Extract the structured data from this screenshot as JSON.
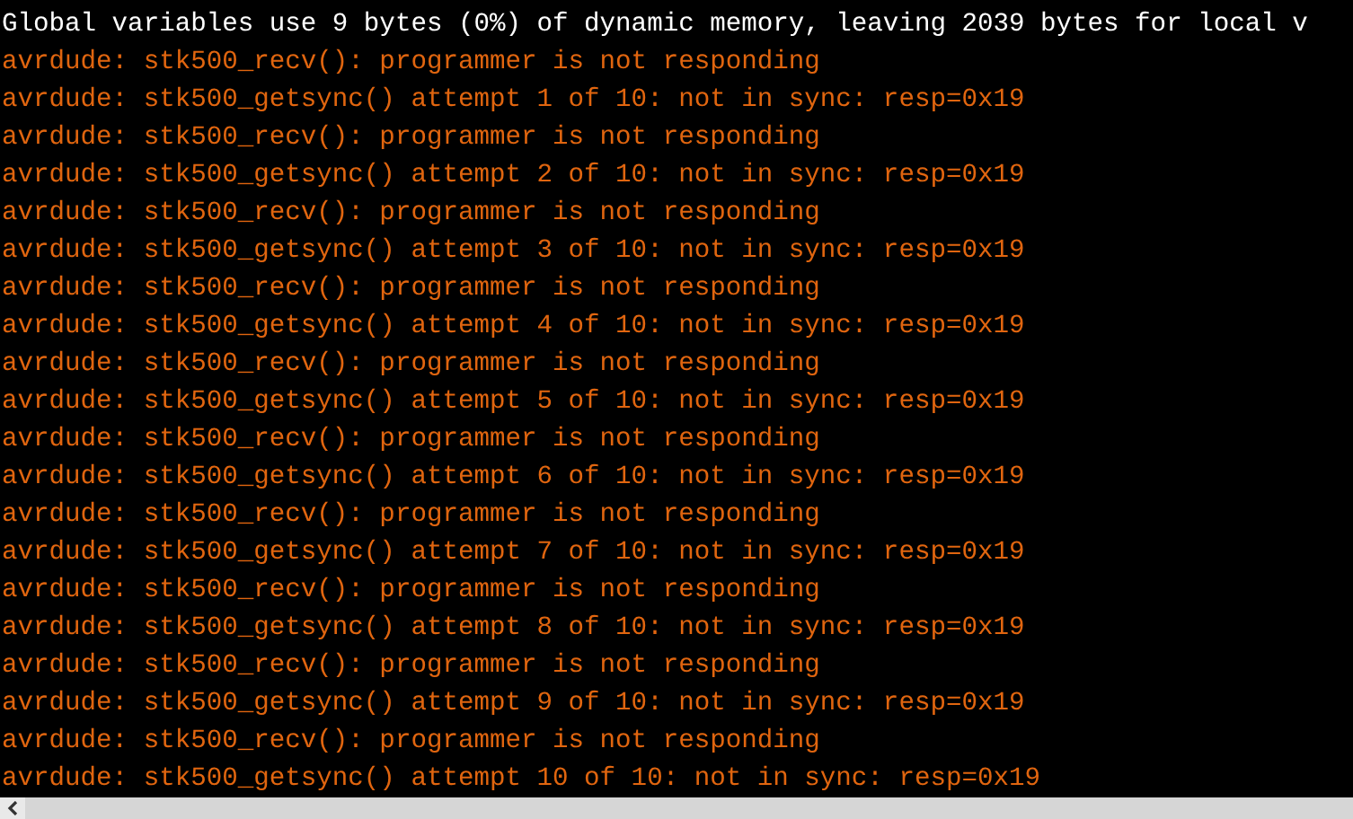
{
  "console": {
    "lines": [
      {
        "kind": "info",
        "text": "Global variables use 9 bytes (0%) of dynamic memory, leaving 2039 bytes for local v"
      },
      {
        "kind": "error",
        "text": "avrdude: stk500_recv(): programmer is not responding"
      },
      {
        "kind": "error",
        "text": "avrdude: stk500_getsync() attempt 1 of 10: not in sync: resp=0x19"
      },
      {
        "kind": "error",
        "text": "avrdude: stk500_recv(): programmer is not responding"
      },
      {
        "kind": "error",
        "text": "avrdude: stk500_getsync() attempt 2 of 10: not in sync: resp=0x19"
      },
      {
        "kind": "error",
        "text": "avrdude: stk500_recv(): programmer is not responding"
      },
      {
        "kind": "error",
        "text": "avrdude: stk500_getsync() attempt 3 of 10: not in sync: resp=0x19"
      },
      {
        "kind": "error",
        "text": "avrdude: stk500_recv(): programmer is not responding"
      },
      {
        "kind": "error",
        "text": "avrdude: stk500_getsync() attempt 4 of 10: not in sync: resp=0x19"
      },
      {
        "kind": "error",
        "text": "avrdude: stk500_recv(): programmer is not responding"
      },
      {
        "kind": "error",
        "text": "avrdude: stk500_getsync() attempt 5 of 10: not in sync: resp=0x19"
      },
      {
        "kind": "error",
        "text": "avrdude: stk500_recv(): programmer is not responding"
      },
      {
        "kind": "error",
        "text": "avrdude: stk500_getsync() attempt 6 of 10: not in sync: resp=0x19"
      },
      {
        "kind": "error",
        "text": "avrdude: stk500_recv(): programmer is not responding"
      },
      {
        "kind": "error",
        "text": "avrdude: stk500_getsync() attempt 7 of 10: not in sync: resp=0x19"
      },
      {
        "kind": "error",
        "text": "avrdude: stk500_recv(): programmer is not responding"
      },
      {
        "kind": "error",
        "text": "avrdude: stk500_getsync() attempt 8 of 10: not in sync: resp=0x19"
      },
      {
        "kind": "error",
        "text": "avrdude: stk500_recv(): programmer is not responding"
      },
      {
        "kind": "error",
        "text": "avrdude: stk500_getsync() attempt 9 of 10: not in sync: resp=0x19"
      },
      {
        "kind": "error",
        "text": "avrdude: stk500_recv(): programmer is not responding"
      },
      {
        "kind": "error",
        "text": "avrdude: stk500_getsync() attempt 10 of 10: not in sync: resp=0x19"
      }
    ]
  }
}
